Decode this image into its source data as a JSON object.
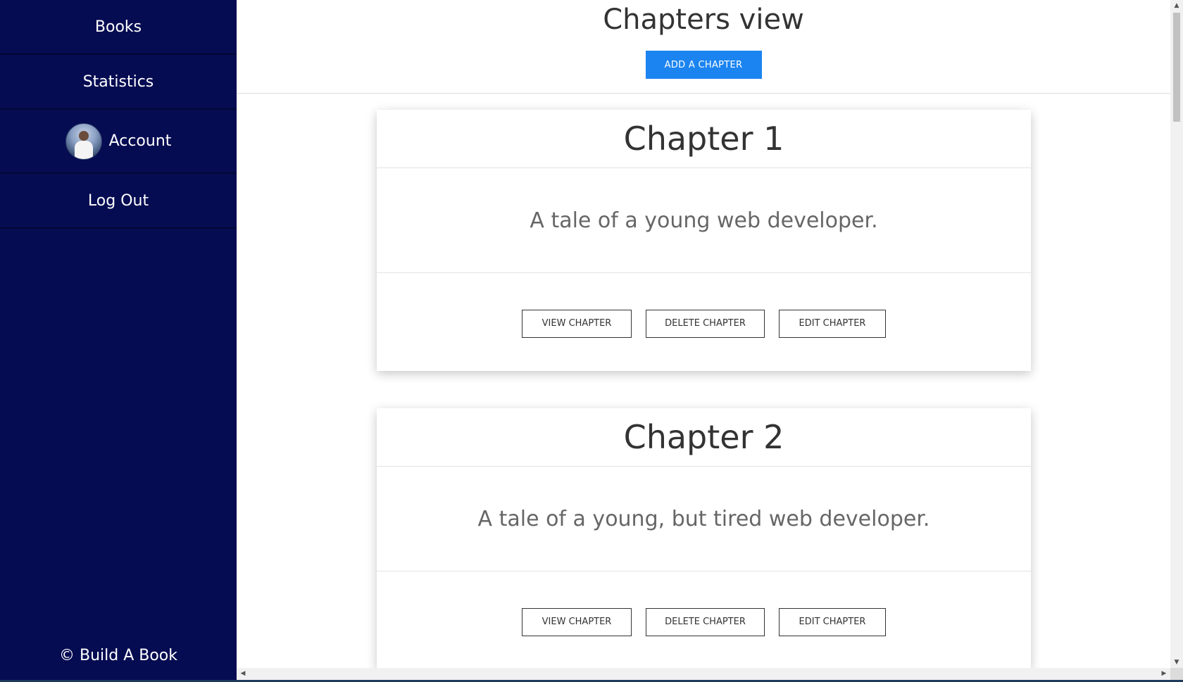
{
  "sidebar": {
    "items": [
      {
        "label": "Books"
      },
      {
        "label": "Statistics"
      },
      {
        "label": "Account"
      },
      {
        "label": "Log Out"
      }
    ],
    "footer": "© Build A Book"
  },
  "header": {
    "title": "Chapters view",
    "add_button_label": "ADD A CHAPTER"
  },
  "chapters": [
    {
      "title": "Chapter 1",
      "description": "A tale of a young web developer.",
      "view_label": "VIEW CHAPTER",
      "delete_label": "DELETE CHAPTER",
      "edit_label": "EDIT CHAPTER"
    },
    {
      "title": "Chapter 2",
      "description": "A tale of a young, but tired web developer.",
      "view_label": "VIEW CHAPTER",
      "delete_label": "DELETE CHAPTER",
      "edit_label": "EDIT CHAPTER"
    }
  ],
  "colors": {
    "sidebar_bg": "#060c52",
    "primary_button": "#1b84f0"
  },
  "icons": {
    "scroll_up": "▲",
    "scroll_down": "▼",
    "scroll_left": "◀",
    "scroll_right": "▶"
  }
}
